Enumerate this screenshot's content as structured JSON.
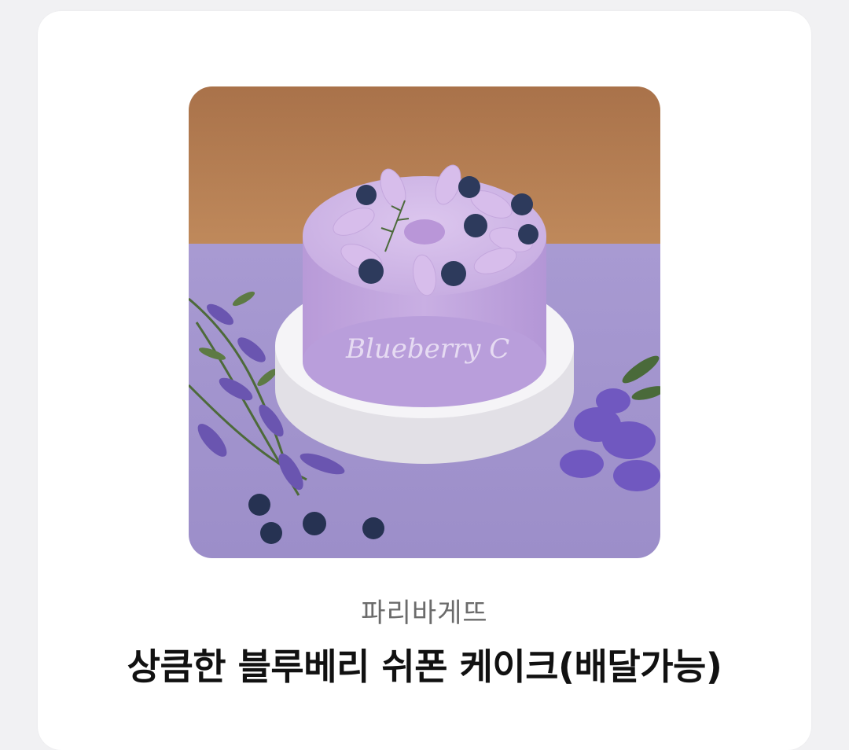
{
  "product": {
    "brand": "파리바게뜨",
    "title": "상큼한 블루베리 쉬폰 케이크(배달가능)",
    "image": {
      "cake_lettering": "Blueberry C"
    }
  },
  "colors": {
    "page_background": "#f1f1f3",
    "card_background": "#ffffff",
    "brand_text": "#6b6b6b",
    "title_text": "#111111"
  }
}
